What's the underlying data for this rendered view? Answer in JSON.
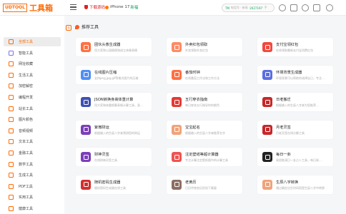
{
  "header": {
    "logo_box": "UDTOOL",
    "logo_text": "工具箱",
    "promo_download": "下载源码",
    "promo_iphone": "iPhone 17",
    "promo_iphone_tag": "新福",
    "search": {
      "tag": "TM",
      "text": "电话号 · 新高 ·",
      "highlight": "2027197",
      "suffix": "· 手"
    }
  },
  "sidebar": {
    "items": [
      {
        "label": "全部工具",
        "color": "#ff6a00",
        "active": true
      },
      {
        "label": "智能工具",
        "color": "#7a6ff0"
      },
      {
        "label": "网址收藏",
        "color": "#ff6a00"
      },
      {
        "label": "生活工具",
        "color": "#ff6a00"
      },
      {
        "label": "加密解密",
        "color": "#ff6a00"
      },
      {
        "label": "编程开发",
        "color": "#ff6a00"
      },
      {
        "label": "站长工具",
        "color": "#ff6a00"
      },
      {
        "label": "图片颜色",
        "color": "#ff6a00"
      },
      {
        "label": "音频视频",
        "color": "#ff6a00"
      },
      {
        "label": "文本工具",
        "color": "#ff6a00"
      },
      {
        "label": "金融工具",
        "color": "#ff6a00"
      },
      {
        "label": "数学工具",
        "color": "#ff6a00"
      },
      {
        "label": "生成工具",
        "color": "#ff6a00"
      },
      {
        "label": "PDF工具",
        "color": "#ff6a00"
      },
      {
        "label": "实用工具",
        "color": "#ff6a00"
      },
      {
        "label": "健康工具",
        "color": "#ff6a00"
      }
    ]
  },
  "section_title": "推荐工具",
  "cards": [
    {
      "title": "团伙头像生成器",
      "desc": "用大家和公园随便独成立体像表情",
      "color": "#ff7043"
    },
    {
      "title": "外卖红包领取",
      "desc": "外卖领取外卖红包",
      "color": "#ff8a65"
    },
    {
      "title": "支付宝领红包",
      "desc": "在线领取最新支付宝消费红包",
      "color": "#f04a3e"
    },
    {
      "title": "在线图片压缩",
      "desc": "支持png,jpg,gif等格式图片的压缩",
      "color": "#4f8ef7"
    },
    {
      "title": "番茄时钟",
      "desc": "在线番茄工作法和工作方法",
      "color": "#ff7043"
    },
    {
      "title": "环境背景生成器",
      "desc": "环境背景可以帮助你选择自己，专注…",
      "color": "#5b6ee1"
    },
    {
      "title": "JSON转换身高体重计算",
      "desc": "用大家和体重换算表格计算工具，身…",
      "color": "#3f51b5"
    },
    {
      "title": "五行穿衣指南",
      "desc": "每日穿衣五行指导你的颜色",
      "color": "#e53935"
    },
    {
      "title": "日老搬迁",
      "desc": "根据输入的生辰八字来为您推荐…",
      "color": "#c62828"
    },
    {
      "title": "紫微财运",
      "desc": "根据输入的生辰八字来预测您的财运",
      "color": "#7b3fb8"
    },
    {
      "title": "宝宝起名",
      "desc": "根据输入的生辰八字来推荐名字",
      "color": "#f0a37a"
    },
    {
      "title": "月老灵签",
      "desc": "月老灵签在线分解工具",
      "color": "#c62828"
    },
    {
      "title": "财神灵签",
      "desc": "在线财神灵签工具",
      "color": "#7b3fb8"
    },
    {
      "title": "注定壁纸等超计算器",
      "desc": "专注计算注定壁纸图中的计算工具",
      "color": "#ef5350"
    },
    {
      "title": "每日一卦",
      "desc": "易经推演日一卦占卜工具，每日易…",
      "color": "#222222"
    },
    {
      "title": "随机密码生成器",
      "desc": "随机密码生成器在线工具",
      "color": "#d32f2f"
    },
    {
      "title": "老黄历",
      "desc": "日历传统农历民俗下载量",
      "color": "#8d6e63"
    },
    {
      "title": "生辰八字转换",
      "desc": "通过确定出生时间而是生辰八字中转换",
      "color": "#f0a37a"
    }
  ]
}
